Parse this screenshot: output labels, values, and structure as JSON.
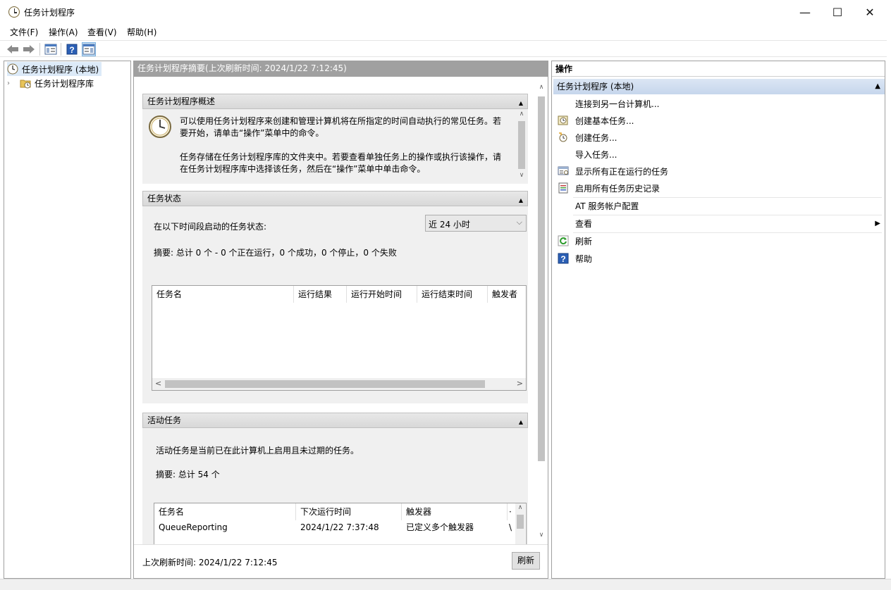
{
  "window": {
    "title": "任务计划程序",
    "minimize_glyph": "—",
    "maximize_glyph": "☐",
    "close_glyph": "✕"
  },
  "menu": {
    "file": "文件(F)",
    "action": "操作(A)",
    "view": "查看(V)",
    "help": "帮助(H)"
  },
  "tree": {
    "root": "任务计划程序 (本地)",
    "library": "任务计划程序库"
  },
  "center": {
    "header": "任务计划程序摘要(上次刷新时间: 2024/1/22 7:12:45)",
    "overview": {
      "title": "任务计划程序概述",
      "para1_line1": "可以使用任务计划程序来创建和管理计算机将在所指定的时间自动执行的常见任务。若",
      "para1_line2": "要开始，请单击“操作”菜单中的命令。",
      "para2_line1": "任务存储在任务计划程序库的文件夹中。若要查看单独任务上的操作或执行该操作，请",
      "para2_line2": "在任务计划程序库中选择该任务，然后在“操作”菜单中单击命令。"
    },
    "status": {
      "title": "任务状态",
      "period_label": "在以下时间段启动的任务状态:",
      "period_value": "近 24 小时",
      "summary": "摘要: 总计 0 个 - 0 个正在运行，0 个成功，0 个停止，0 个失败",
      "columns": [
        "任务名",
        "运行结果",
        "运行开始时间",
        "运行结束时间",
        "触发者"
      ]
    },
    "active": {
      "title": "活动任务",
      "description": "活动任务是当前已在此计算机上启用且未过期的任务。",
      "summary": "摘要: 总计 54 个",
      "columns": [
        "任务名",
        "下次运行时间",
        "触发器",
        "·"
      ],
      "rows": [
        {
          "name": "QueueReporting",
          "next_run": "2024/1/22 7:37:48",
          "trigger": "已定义多个触发器",
          "extra": "\\"
        }
      ]
    },
    "footer": {
      "last_refresh": "上次刷新时间: 2024/1/22 7:12:45",
      "refresh_button": "刷新"
    }
  },
  "actions": {
    "title": "操作",
    "section": "任务计划程序 (本地)",
    "items": [
      {
        "label": "连接到另一台计算机...",
        "icon": "none"
      },
      {
        "label": "创建基本任务...",
        "icon": "basic-task-icon"
      },
      {
        "label": "创建任务...",
        "icon": "create-task-icon"
      },
      {
        "label": "导入任务...",
        "icon": "none"
      },
      {
        "label": "显示所有正在运行的任务",
        "icon": "running-tasks-icon"
      },
      {
        "label": "启用所有任务历史记录",
        "icon": "history-icon"
      },
      {
        "label": "AT 服务帐户配置",
        "icon": "none"
      },
      {
        "label": "查看",
        "icon": "none"
      },
      {
        "label": "刷新",
        "icon": "refresh-icon"
      },
      {
        "label": "帮助",
        "icon": "help-icon"
      }
    ]
  }
}
